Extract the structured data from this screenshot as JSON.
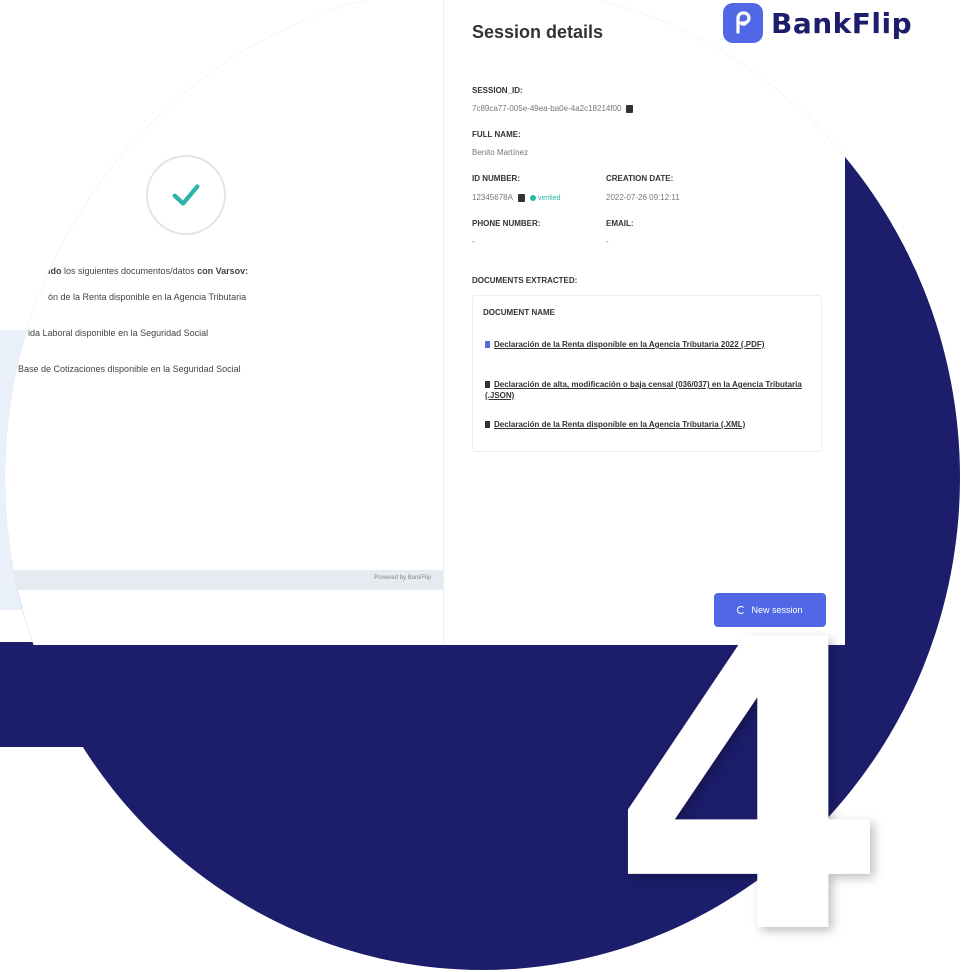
{
  "brand": {
    "name": "BankFlip"
  },
  "colors": {
    "navy": "#1c1d6b",
    "accent": "#5068e6",
    "verified": "#2ab5a8"
  },
  "left": {
    "intro_prefix": "ido",
    "intro_middle": " los siguientes documentos/datos ",
    "intro_suffix": "con Varsov:",
    "lines": [
      "ón de la Renta disponible en la Agencia Tributaria",
      "ida Laboral disponible en la Seguridad Social",
      "Base de Cotizaciones disponible en la Seguridad Social"
    ],
    "powered_by": "Powered by BankFlip"
  },
  "session": {
    "title": "Session details",
    "session_id_label": "SESSION_ID:",
    "session_id_value": "7c89ca77-005e-49ea-ba0e-4a2c18214f00",
    "full_name_label": "FULL NAME:",
    "full_name_value": "Benito Martínez",
    "id_number_label": "ID NUMBER:",
    "id_number_value": "12345678A",
    "verified_label": "verified",
    "creation_date_label": "CREATION DATE:",
    "creation_date_value": "2022-07-26 09:12:11",
    "phone_label": "PHONE NUMBER:",
    "phone_value": "-",
    "email_label": "EMAIL:",
    "email_value": "-",
    "documents_label": "DOCUMENTS EXTRACTED:",
    "document_name_header": "DOCUMENT NAME",
    "documents": [
      "Declaración de la Renta disponible en la Agencia Tributaria 2022 (.PDF)",
      "Declaración de alta, modificación o baja censal (036/037) en la Agencia Tributaria (.JSON)",
      "Declaración de la Renta disponible en la Agencia Tributaria (.XML)"
    ],
    "new_session_label": "New session"
  },
  "hero_number": "4"
}
